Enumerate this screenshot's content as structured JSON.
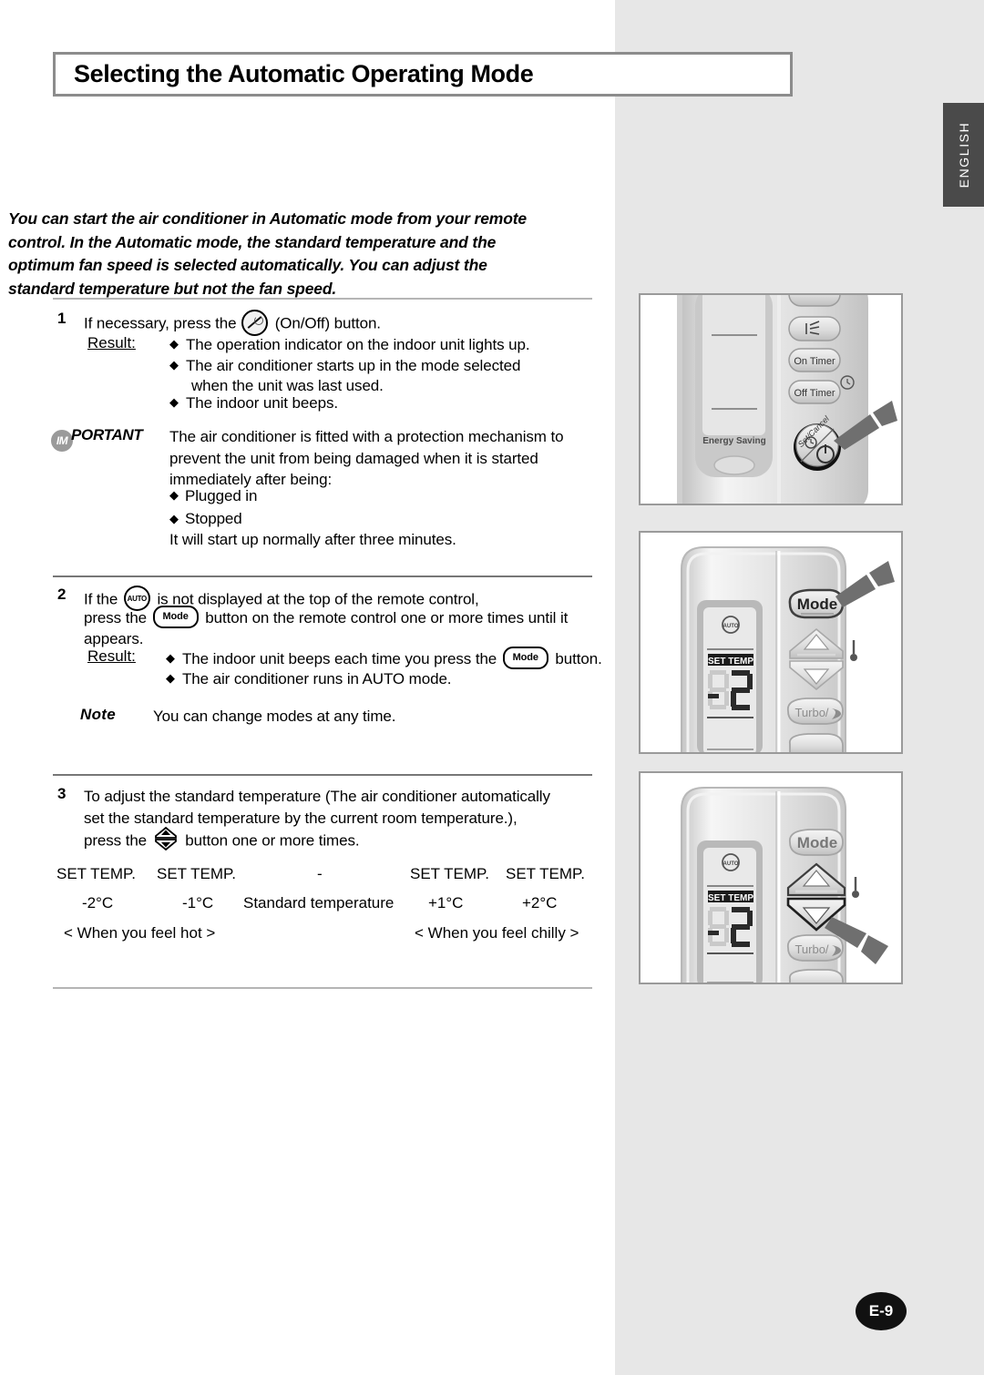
{
  "page": {
    "title": "Selecting the Automatic Operating Mode",
    "language_tab": "ENGLISH",
    "page_number": "E-9"
  },
  "intro": "You can start the air conditioner in Automatic mode from your remote control. In the Automatic mode, the standard temperature and the optimum fan speed is selected automatically. You can adjust the standard temperature but not the fan speed.",
  "step1": {
    "number": "1",
    "text_before_icon": "If necessary, press the",
    "icon": "on-off-icon",
    "text_after_icon": "(On/Off) button.",
    "result_label": "Result:",
    "results": [
      "The operation indicator on the indoor unit lights up.",
      "The air conditioner starts up in the mode selected",
      "when the unit was last used.",
      "The indoor unit beeps."
    ]
  },
  "important": {
    "badge_prefix": "IM",
    "badge_suffix": "PORTANT",
    "lines": [
      "The air conditioner is fitted with a protection mechanism to",
      "prevent the unit from being damaged when it is started",
      "immediately after being:"
    ],
    "bullets": [
      "Plugged in",
      "Stopped"
    ],
    "closing": "It will start up normally after three minutes."
  },
  "step2": {
    "number": "2",
    "line1_a": "If the",
    "line1_icon": "auto-icon",
    "line1_b": "is not displayed at the top of the remote control,",
    "line2_a": "press the",
    "line2_icon": "mode-button-icon",
    "line2_b": "button on the remote control one or more times until it",
    "line3": "appears.",
    "result_label": "Result:",
    "result1_a": "The indoor unit beeps each time you press the",
    "result1_icon": "mode-button-icon",
    "result1_b": "button.",
    "result2": "The air conditioner runs in AUTO mode.",
    "note_badge": "Note",
    "note_text": "You can change modes at any time."
  },
  "step3": {
    "number": "3",
    "line1": "To adjust the standard temperature (The air conditioner automatically",
    "line2": "set the standard temperature by the current room temperature.),",
    "line3_a": "press the",
    "line3_icon": "up-down-arrow-icon",
    "line3_b": "button one or more times.",
    "table": {
      "headers": [
        "SET TEMP.",
        "SET TEMP.",
        "-",
        "SET TEMP.",
        "SET TEMP."
      ],
      "values": [
        "-2°C",
        "-1°C",
        "Standard temperature",
        "+1°C",
        "+2°C"
      ],
      "caption_left": "< When you feel hot >",
      "caption_right": "< When you feel chilly >"
    }
  },
  "illustrations": {
    "panel1": {
      "name": "remote-top-onoff-illustration",
      "labels": {
        "energy_saving": "Energy Saving",
        "on_timer": "On Timer",
        "off_timer": "Off Timer",
        "set_cancel": "Set/Cancel"
      }
    },
    "panel2": {
      "name": "remote-mode-button-illustration",
      "labels": {
        "mode": "Mode",
        "set_temp": "SET TEMP",
        "turbo": "Turbo/",
        "display_value": "2"
      }
    },
    "panel3": {
      "name": "remote-temp-down-illustration",
      "labels": {
        "mode": "Mode",
        "set_temp": "SET TEMP",
        "turbo": "Turbo/",
        "display_value": "2"
      }
    }
  },
  "colors": {
    "gray_band": "#e7e7e7",
    "tab_bg": "#4a4a4a",
    "rule": "#b5b5b5",
    "remote_body": "#d9d9d9"
  }
}
